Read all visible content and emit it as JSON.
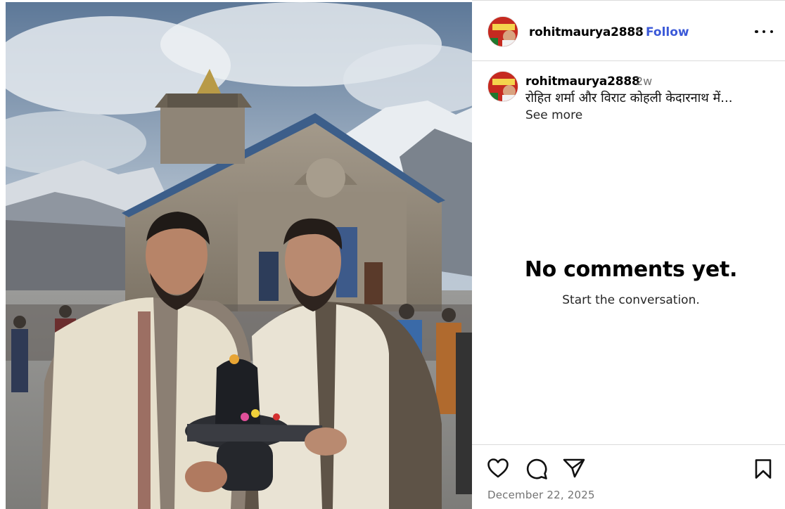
{
  "post": {
    "photo_description_icon": "photo",
    "username": "rohitmaurya2888",
    "follow_label": "Follow",
    "separator": "•",
    "more_icon": "more-horizontal-icon",
    "time_ago": "2w",
    "caption": "रोहित शर्मा और विराट कोहली केदारनाथ में...",
    "see_more_label": "See more",
    "date": "December 22, 2025"
  },
  "comments": {
    "empty_title": "No comments yet.",
    "empty_subtitle": "Start the conversation."
  },
  "actions": {
    "like_icon": "heart-icon",
    "comment_icon": "comment-icon",
    "share_icon": "paper-plane-icon",
    "save_icon": "bookmark-icon"
  },
  "colors": {
    "follow": "#3b59d8",
    "muted": "#737373",
    "divider": "#dbdbdb"
  }
}
